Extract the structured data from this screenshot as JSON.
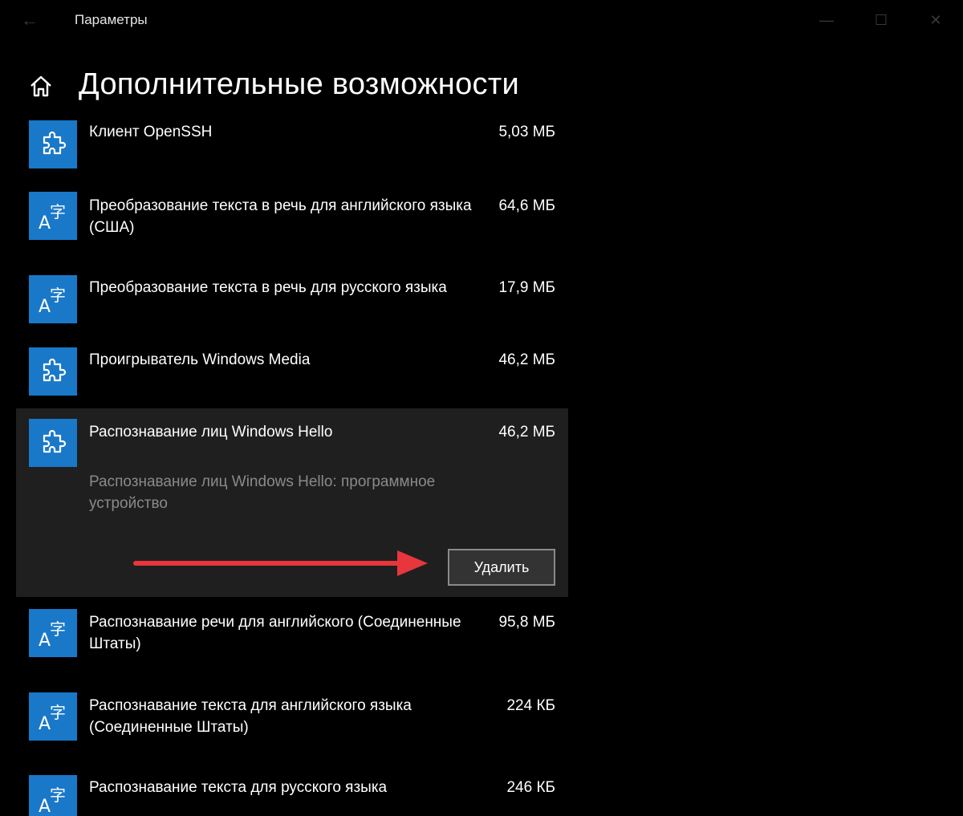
{
  "window": {
    "title": "Параметры",
    "back_icon": "back-arrow-icon",
    "controls": [
      "minimize-icon",
      "maximize-icon",
      "close-icon"
    ]
  },
  "header": {
    "home_icon": "home-icon",
    "title": "Дополнительные возможности"
  },
  "features": [
    {
      "name": "Клиент OpenSSH",
      "size": "5,03 МБ",
      "icon": "puzzle-icon"
    },
    {
      "name": "Преобразование текста в речь для английского языка (США)",
      "size": "64,6 МБ",
      "icon": "language-icon"
    },
    {
      "name": "Преобразование текста в речь для русского языка",
      "size": "17,9 МБ",
      "icon": "language-icon"
    },
    {
      "name": "Проигрыватель Windows Media",
      "size": "46,2 МБ",
      "icon": "puzzle-icon"
    },
    {
      "name": "Распознавание лиц Windows Hello",
      "size": "46,2 МБ",
      "icon": "puzzle-icon",
      "description": "Распознавание лиц Windows Hello: программное устройство",
      "uninstall_label": "Удалить"
    },
    {
      "name": "Распознавание речи для английского (Соединенные Штаты)",
      "size": "95,8 МБ",
      "icon": "language-icon"
    },
    {
      "name": "Распознавание текста для английского языка (Соединенные Штаты)",
      "size": "224 КБ",
      "icon": "language-icon"
    },
    {
      "name": "Распознавание текста для русского языка",
      "size": "246 КБ",
      "icon": "language-icon"
    }
  ],
  "annotation": {
    "arrow_color": "#e8363c"
  },
  "colors": {
    "accent": "#1a78c9",
    "background": "#000000",
    "expanded_background": "#1f1f1f"
  }
}
